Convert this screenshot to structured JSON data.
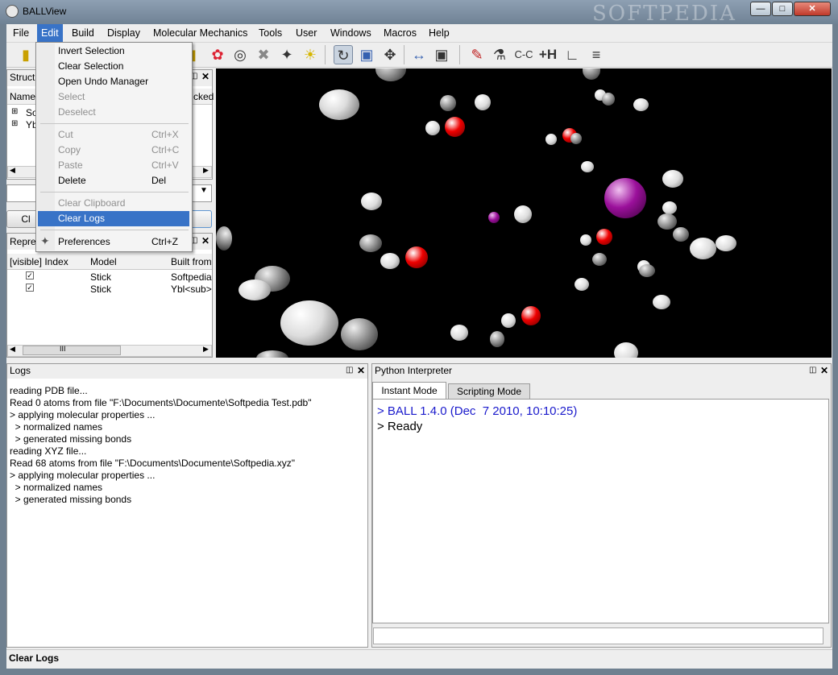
{
  "window": {
    "title": "BALLView",
    "watermark": "SOFTPEDIA"
  },
  "menubar": [
    "File",
    "Edit",
    "Build",
    "Display",
    "Molecular Mechanics",
    "Tools",
    "User",
    "Windows",
    "Macros",
    "Help"
  ],
  "edit_menu": {
    "invert_selection": "Invert Selection",
    "clear_selection": "Clear Selection",
    "open_undo_manager": "Open Undo Manager",
    "select": "Select",
    "deselect": "Deselect",
    "cut": "Cut",
    "cut_acc": "Ctrl+X",
    "copy": "Copy",
    "copy_acc": "Ctrl+C",
    "paste": "Paste",
    "paste_acc": "Ctrl+V",
    "delete": "Delete",
    "delete_acc": "Del",
    "clear_clipboard": "Clear Clipboard",
    "clear_logs": "Clear Logs",
    "preferences": "Preferences",
    "preferences_acc": "Ctrl+Z"
  },
  "structures_panel": {
    "title": "Struct",
    "col_name": "Name",
    "col_checked": "cked",
    "items": [
      "So",
      "Ybl"
    ],
    "button_left": "Cl"
  },
  "representations_panel": {
    "title": "Repre",
    "cols": [
      "[visible] Index",
      "Model",
      "Built from"
    ],
    "rows": [
      {
        "model": "Stick",
        "built_from": "Softpedia"
      },
      {
        "model": "Stick",
        "built_from": "Ybl<sub>"
      }
    ],
    "scroll_thumb": "III"
  },
  "logs_panel": {
    "title": "Logs",
    "lines": [
      "reading PDB file...",
      "Read 0 atoms from file \"F:\\Documents\\Documente\\Softpedia Test.pdb\"",
      "> applying molecular properties ...",
      "  > normalized names",
      "  > generated missing bonds",
      "reading XYZ file...",
      "Read 68 atoms from file \"F:\\Documents\\Documente\\Softpedia.xyz\"",
      "> applying molecular properties ...",
      "  > normalized names",
      "  > generated missing bonds"
    ]
  },
  "python_panel": {
    "title": "Python Interpreter",
    "tabs": [
      "Instant Mode",
      "Scripting Mode"
    ],
    "output": [
      "> BALL 1.4.0 (Dec  7 2010, 10:10:25)",
      "> Ready"
    ]
  },
  "status": {
    "text": "Clear Logs"
  },
  "toolbar": {
    "labels": [
      "C-C",
      "+H"
    ]
  },
  "colors": {
    "selection": "#3873c7",
    "oxygen": "#e00000",
    "carbon": "#9a9a9a",
    "hydrogen": "#ffffff",
    "special": "#9b109b",
    "interpreter_blue": "#1a1acc"
  }
}
